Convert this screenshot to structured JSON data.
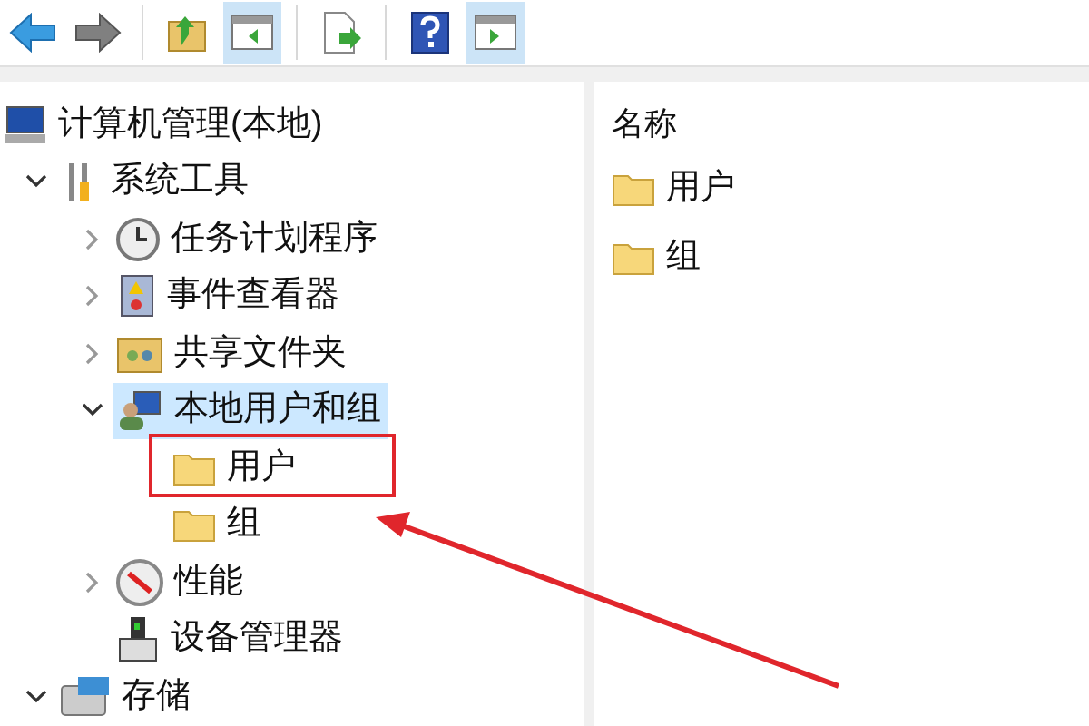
{
  "toolbar": {
    "buttons": [
      {
        "kind": "back",
        "pressed": false
      },
      {
        "kind": "forward",
        "pressed": false
      },
      {
        "kind": "up",
        "pressed": false
      },
      {
        "kind": "tree",
        "pressed": true
      },
      {
        "kind": "export",
        "pressed": false
      },
      {
        "kind": "help",
        "pressed": false
      },
      {
        "kind": "action",
        "pressed": true
      }
    ]
  },
  "tree": [
    {
      "label": "计算机管理(本地)",
      "kind": "computer",
      "selected": false,
      "children": [
        {
          "label": "系统工具",
          "kind": "tools",
          "expanded": true,
          "selected": false,
          "children": [
            {
              "label": "任务计划程序",
              "kind": "clock",
              "expanded": false,
              "selected": false
            },
            {
              "label": "事件查看器",
              "kind": "log",
              "expanded": false,
              "selected": false
            },
            {
              "label": "共享文件夹",
              "kind": "share",
              "expanded": false,
              "selected": false
            },
            {
              "label": "本地用户和组",
              "kind": "users",
              "expanded": true,
              "selected": true,
              "children": [
                {
                  "label": "用户",
                  "kind": "folder",
                  "selected": false
                },
                {
                  "label": "组",
                  "kind": "folder",
                  "selected": false
                }
              ]
            },
            {
              "label": "性能",
              "kind": "gauge",
              "expanded": false,
              "selected": false
            },
            {
              "label": "设备管理器",
              "kind": "device",
              "selected": false
            }
          ]
        },
        {
          "label": "存储",
          "kind": "storage",
          "expanded": true,
          "selected": false
        }
      ]
    }
  ],
  "list": {
    "column": "名称",
    "items": [
      {
        "label": "用户"
      },
      {
        "label": "组"
      }
    ]
  }
}
